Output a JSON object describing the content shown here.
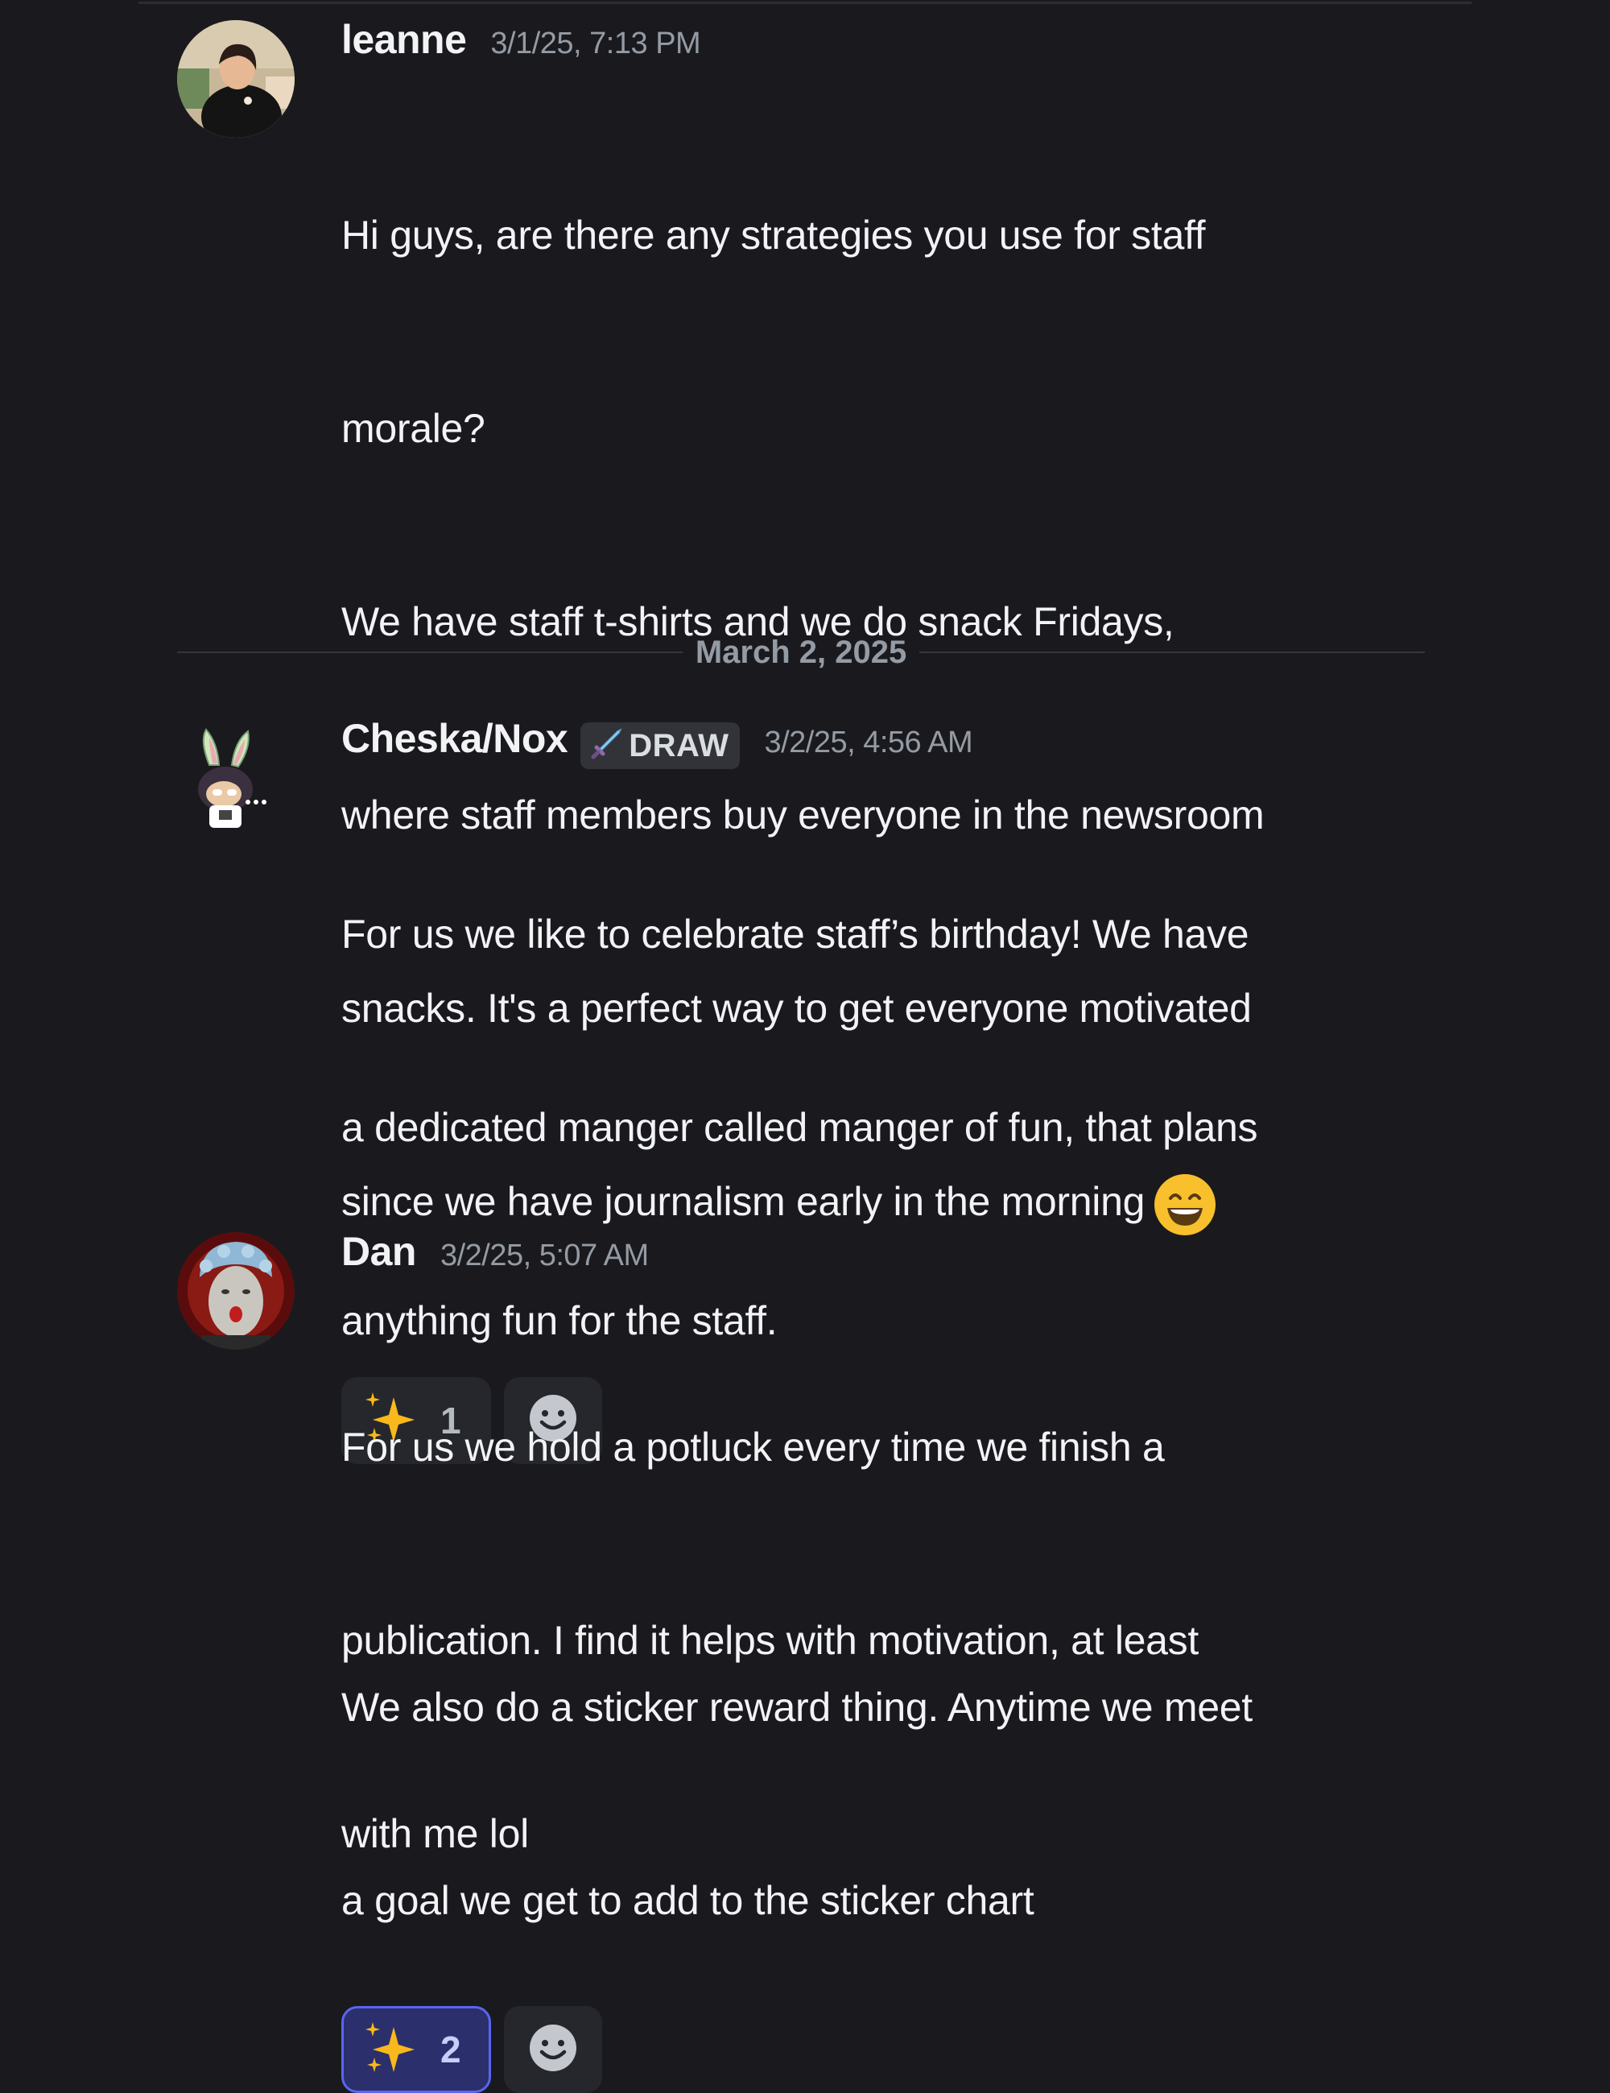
{
  "messages": [
    {
      "username": "leanne",
      "timestamp": "3/1/25, 7:13 PM",
      "lines": [
        "Hi guys, are there any strategies you use for staff",
        "morale?",
        "We have staff t-shirts and we do snack Fridays,",
        "where staff members buy everyone in the newsroom",
        "snacks. It's a perfect way to get everyone motivated",
        "since we have journalism early in the morning"
      ],
      "reactions": [
        {
          "emoji": "sparkles-icon",
          "count": "1",
          "active": false
        }
      ]
    },
    {
      "username": "Cheska/Nox",
      "role_badge": "DRAW",
      "timestamp": "3/2/25, 4:56 AM",
      "lines": [
        "For us we like to celebrate staff’s birthday! We have",
        "a dedicated manger called manger of fun, that plans",
        "anything fun for the staff.",
        "",
        "We also do a sticker reward thing. Anytime we meet",
        "a goal we get to add to the sticker chart"
      ]
    },
    {
      "username": "Dan",
      "timestamp": "3/2/25, 5:07 AM",
      "lines": [
        "For us we hold a potluck every time we finish a",
        "publication. I find it helps with motivation, at least",
        "with me lol"
      ],
      "reactions": [
        {
          "emoji": "sparkles-icon",
          "count": "2",
          "active": true
        }
      ]
    }
  ],
  "date_divider": "March 2, 2025",
  "colors": {
    "background": "#1a1a1e",
    "reaction_active_border": "#5865f2",
    "reaction_active_bg": "#2b2f6b"
  }
}
